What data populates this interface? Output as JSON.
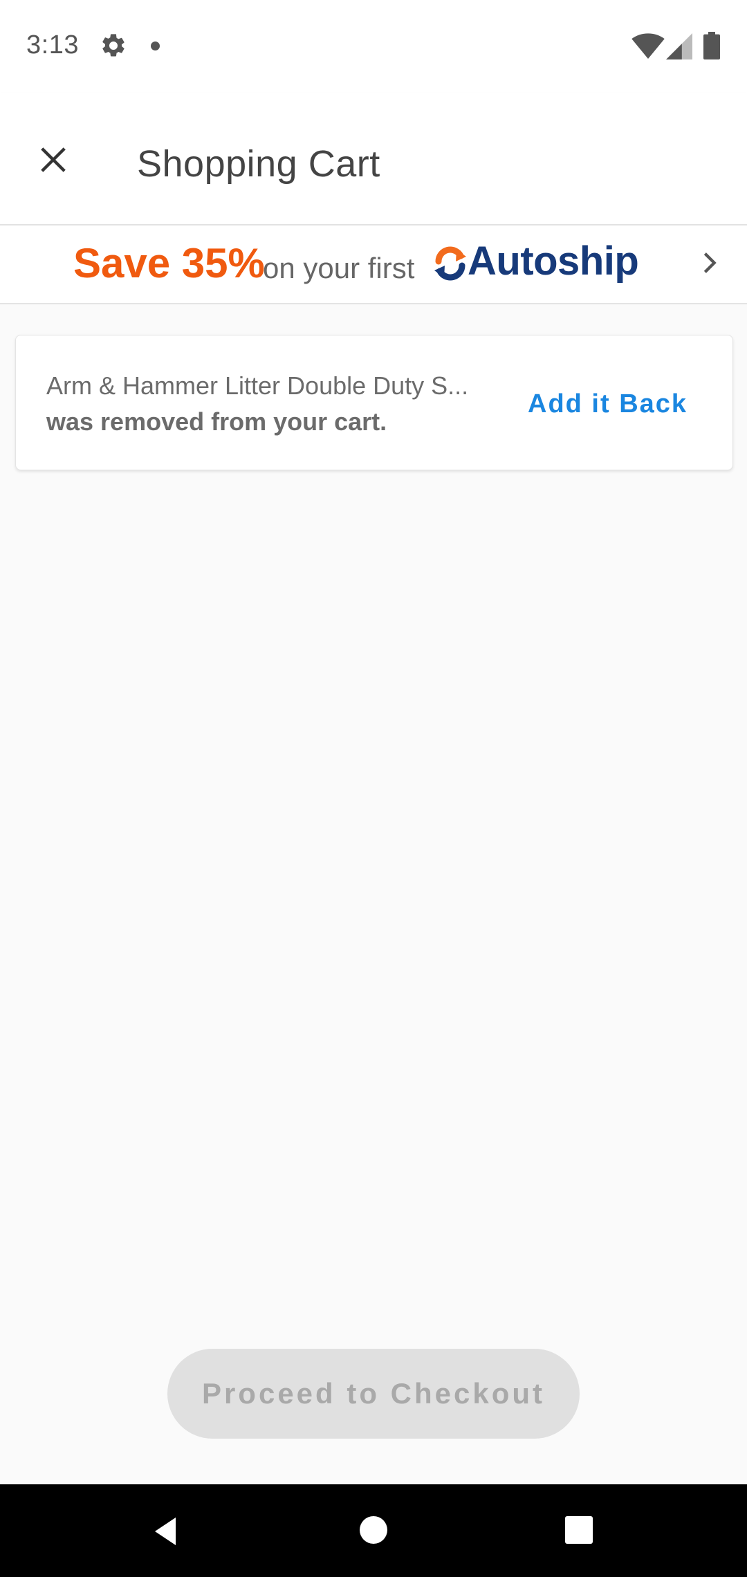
{
  "status_bar": {
    "time": "3:13",
    "icons": [
      "gear-icon",
      "notification-dot-icon",
      "wifi-icon",
      "cell-signal-icon",
      "battery-icon"
    ]
  },
  "header": {
    "title": "Shopping Cart",
    "close_icon": "close-icon"
  },
  "promo": {
    "save_text": "Save 35%",
    "middle_text": "on your first",
    "brand_text": "Autoship",
    "brand_icon": "autoship-refresh-icon",
    "chevron_icon": "chevron-right-icon",
    "colors": {
      "save": "#f05a0f",
      "brand": "#173a7a",
      "icon_orange": "#f26b1d"
    }
  },
  "notice": {
    "product_name": "Arm & Hammer Litter Double Duty S...",
    "message": "was removed from your cart.",
    "action_label": "Add it Back",
    "action_color": "#1a86e0"
  },
  "checkout": {
    "label": "Proceed to Checkout",
    "state": "disabled"
  },
  "nav_bar": {
    "icons": [
      "back-icon",
      "home-icon",
      "recents-icon"
    ]
  }
}
